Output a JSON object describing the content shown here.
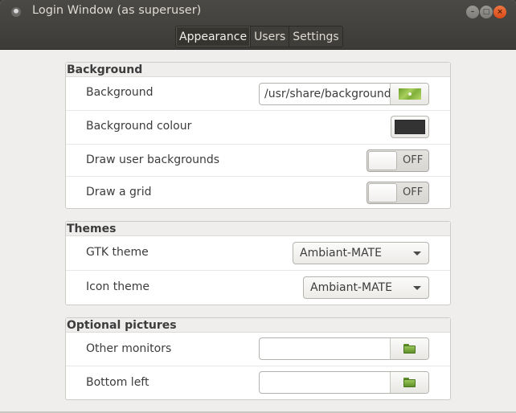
{
  "window": {
    "title": "Login Window (as superuser)",
    "controls": [
      "minimize",
      "maximize",
      "close"
    ]
  },
  "tabs": [
    {
      "label": "Appearance",
      "active": true
    },
    {
      "label": "Users",
      "active": false
    },
    {
      "label": "Settings",
      "active": false
    }
  ],
  "background_section": {
    "header": "Background",
    "rows": {
      "background": {
        "label": "Background",
        "value": "/usr/share/backgrounds/"
      },
      "colour": {
        "label": "Background colour",
        "color": "#333333"
      },
      "user_backgrounds": {
        "label": "Draw user backgrounds",
        "state": "OFF"
      },
      "grid": {
        "label": "Draw a grid",
        "state": "OFF"
      }
    }
  },
  "themes_section": {
    "header": "Themes",
    "rows": {
      "gtk": {
        "label": "GTK theme",
        "value": "Ambiant-MATE"
      },
      "icon": {
        "label": "Icon theme",
        "value": "Ambiant-MATE"
      }
    }
  },
  "pictures_section": {
    "header": "Optional pictures",
    "rows": {
      "other_monitors": {
        "label": "Other monitors",
        "value": ""
      },
      "bottom_left": {
        "label": "Bottom left",
        "value": ""
      }
    }
  },
  "icons": {
    "app": "login-window-icon",
    "background_preview": "image-thumbnail-icon",
    "file_chooser": "folder-icon"
  },
  "colors": {
    "titlebar": "#3c3b37",
    "close_button": "#e9541f",
    "window_bg": "#efeeed"
  }
}
